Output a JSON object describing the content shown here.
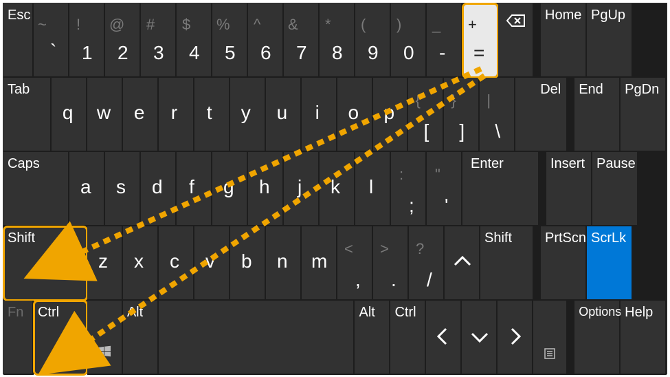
{
  "row1": {
    "esc": "Esc",
    "nums": [
      {
        "top": "~",
        "bot": "`"
      },
      {
        "top": "!",
        "bot": "1"
      },
      {
        "top": "@",
        "bot": "2"
      },
      {
        "top": "#",
        "bot": "3"
      },
      {
        "top": "$",
        "bot": "4"
      },
      {
        "top": "%",
        "bot": "5"
      },
      {
        "top": "^",
        "bot": "6"
      },
      {
        "top": "&",
        "bot": "7"
      },
      {
        "top": "*",
        "bot": "8"
      },
      {
        "top": "(",
        "bot": "9"
      },
      {
        "top": ")",
        "bot": "0"
      },
      {
        "top": "_",
        "bot": "-"
      },
      {
        "top": "+",
        "bot": "="
      }
    ],
    "backspace_icon": "⌫",
    "home": "Home",
    "pgup": "PgUp"
  },
  "row2": {
    "tab": "Tab",
    "letters": [
      "q",
      "w",
      "e",
      "r",
      "t",
      "y",
      "u",
      "i",
      "o",
      "p"
    ],
    "brackets": [
      {
        "top": "{",
        "bot": "["
      },
      {
        "top": "}",
        "bot": "]"
      },
      {
        "top": "|",
        "bot": "\\"
      }
    ],
    "del": "Del",
    "end": "End",
    "pgdn": "PgDn"
  },
  "row3": {
    "caps": "Caps",
    "letters": [
      "a",
      "s",
      "d",
      "f",
      "g",
      "h",
      "j",
      "k",
      "l"
    ],
    "punct": [
      {
        "top": ":",
        "bot": ";"
      },
      {
        "top": "\"",
        "bot": "'"
      }
    ],
    "enter": "Enter",
    "insert": "Insert",
    "pause": "Pause"
  },
  "row4": {
    "shift_l": "Shift",
    "letters": [
      "z",
      "x",
      "c",
      "v",
      "b",
      "n",
      "m"
    ],
    "punct": [
      {
        "top": "<",
        "bot": ","
      },
      {
        "top": ">",
        "bot": "."
      },
      {
        "top": "?",
        "bot": "/"
      }
    ],
    "up_icon": "up",
    "shift_r": "Shift",
    "prtscn": "PrtScn",
    "scrlk": "ScrLk"
  },
  "row5": {
    "fn": "Fn",
    "ctrl_l": "Ctrl",
    "win_icon": "win",
    "alt_l": "Alt",
    "alt_r": "Alt",
    "ctrl_r": "Ctrl",
    "left_icon": "left",
    "down_icon": "down",
    "right_icon": "right",
    "menu_icon": "menu",
    "options": "Options",
    "help": "Help"
  },
  "colors": {
    "highlight": "#f0a500",
    "active": "#0078d7"
  }
}
